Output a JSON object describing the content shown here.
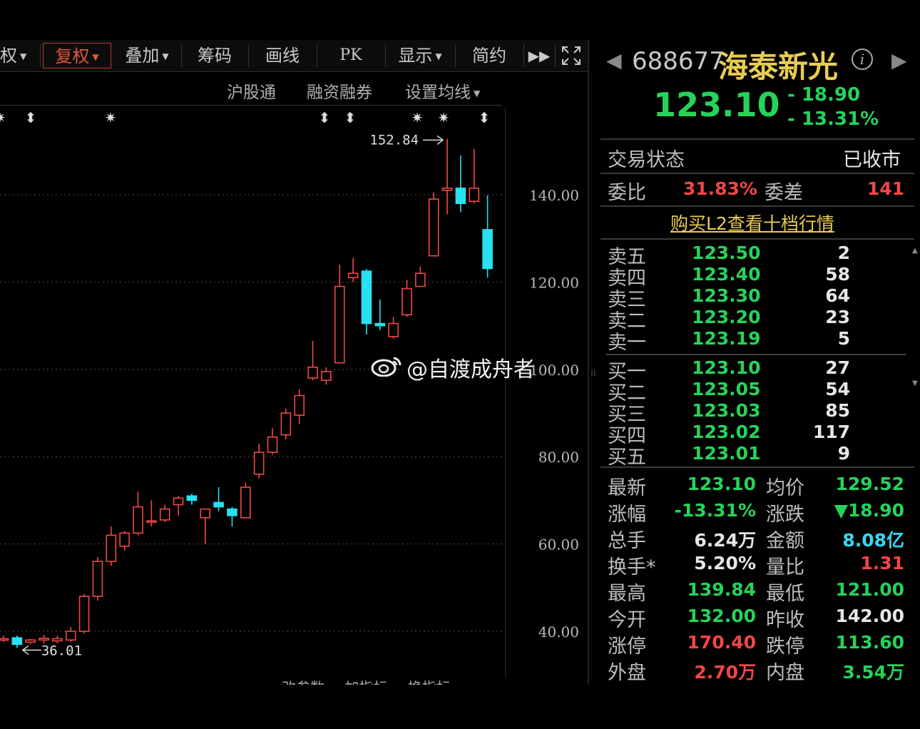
{
  "toolbar": {
    "items": [
      "复权",
      "叠加",
      "筹码",
      "画线",
      "PK",
      "显示",
      "简约"
    ],
    "partial_left": "权"
  },
  "subheader": {
    "hgt": "沪股通",
    "margin": "融资融券",
    "ma": "设置均线"
  },
  "chart": {
    "marker_high": "152.84",
    "marker_low": "36.01",
    "yticks": [
      "140.00",
      "120.00",
      "100.00",
      "80.00",
      "60.00",
      "40.00"
    ],
    "ytick_values": [
      140,
      120,
      100,
      80,
      60,
      40
    ]
  },
  "watermark": "@自渡成舟者",
  "bottom_tabs": [
    "改参数",
    "加指标",
    "换指标"
  ],
  "panel": {
    "code": "688677",
    "name": "海泰新光",
    "last": "123.10",
    "chg_abs": "- 18.90",
    "chg_pct": "- 13.31%",
    "status_label": "交易状态",
    "status_value": "已收市",
    "weibi_label": "委比",
    "weibi_value": "31.83%",
    "weicha_label": "委差",
    "weicha_value": "141",
    "l2_link": "购买L2查看十档行情",
    "asks": [
      {
        "label": "卖五",
        "price": "123.50",
        "vol": "2"
      },
      {
        "label": "卖四",
        "price": "123.40",
        "vol": "58"
      },
      {
        "label": "卖三",
        "price": "123.30",
        "vol": "64"
      },
      {
        "label": "卖二",
        "price": "123.20",
        "vol": "23"
      },
      {
        "label": "卖一",
        "price": "123.19",
        "vol": "5"
      }
    ],
    "bids": [
      {
        "label": "买一",
        "price": "123.10",
        "vol": "27"
      },
      {
        "label": "买二",
        "price": "123.05",
        "vol": "54"
      },
      {
        "label": "买三",
        "price": "123.03",
        "vol": "85"
      },
      {
        "label": "买四",
        "price": "123.02",
        "vol": "117"
      },
      {
        "label": "买五",
        "price": "123.01",
        "vol": "9"
      }
    ],
    "stats": [
      {
        "l1": "最新",
        "v1": "123.10",
        "c1": "green",
        "l2": "均价",
        "v2": "129.52",
        "c2": "green"
      },
      {
        "l1": "涨幅",
        "v1": "-13.31%",
        "c1": "green",
        "l2": "涨跌",
        "v2": "▼18.90",
        "c2": "green"
      },
      {
        "l1": "总手",
        "v1": "6.24万",
        "c1": "white",
        "l2": "金额",
        "v2": "8.08亿",
        "c2": "cyan"
      },
      {
        "l1": "换手*",
        "v1": "5.20%",
        "c1": "white",
        "l2": "量比",
        "v2": "1.31",
        "c2": "red"
      },
      {
        "l1": "最高",
        "v1": "139.84",
        "c1": "green",
        "l2": "最低",
        "v2": "121.00",
        "c2": "green"
      },
      {
        "l1": "今开",
        "v1": "132.00",
        "c1": "green",
        "l2": "昨收",
        "v2": "142.00",
        "c2": "white"
      },
      {
        "l1": "涨停",
        "v1": "170.40",
        "c1": "red",
        "l2": "跌停",
        "v2": "113.60",
        "c2": "green"
      },
      {
        "l1": "外盘",
        "v1": "2.70万",
        "c1": "red",
        "l2": "内盘",
        "v2": "3.54万",
        "c2": "green"
      }
    ]
  },
  "chart_data": {
    "type": "candlestick",
    "ylim": [
      34,
      156
    ],
    "yticks": [
      40,
      60,
      80,
      100,
      120,
      140
    ],
    "candles": [
      {
        "o": 38.0,
        "h": 39.0,
        "l": 37.5,
        "c": 38.3
      },
      {
        "o": 38.5,
        "h": 39.0,
        "l": 36.2,
        "c": 37.0
      },
      {
        "o": 37.5,
        "h": 38.3,
        "l": 37.0,
        "c": 38.0
      },
      {
        "o": 38.0,
        "h": 39.2,
        "l": 37.2,
        "c": 38.4
      },
      {
        "o": 37.8,
        "h": 39.0,
        "l": 37.2,
        "c": 38.3
      },
      {
        "o": 38.0,
        "h": 41.0,
        "l": 37.5,
        "c": 40.0
      },
      {
        "o": 40.0,
        "h": 48.5,
        "l": 39.5,
        "c": 48.0
      },
      {
        "o": 48.0,
        "h": 57.0,
        "l": 47.0,
        "c": 56.0
      },
      {
        "o": 56.0,
        "h": 64.0,
        "l": 55.0,
        "c": 62.0
      },
      {
        "o": 59.5,
        "h": 63.0,
        "l": 58.5,
        "c": 62.5
      },
      {
        "o": 62.5,
        "h": 72.0,
        "l": 62.0,
        "c": 68.5
      },
      {
        "o": 65.0,
        "h": 70.0,
        "l": 64.0,
        "c": 65.3
      },
      {
        "o": 65.5,
        "h": 69.0,
        "l": 65.0,
        "c": 68.0
      },
      {
        "o": 69.0,
        "h": 71.0,
        "l": 66.5,
        "c": 70.5
      },
      {
        "o": 71.0,
        "h": 71.5,
        "l": 69.0,
        "c": 70.0
      },
      {
        "o": 66.0,
        "h": 68.0,
        "l": 60.0,
        "c": 68.0
      },
      {
        "o": 69.5,
        "h": 73.0,
        "l": 67.5,
        "c": 68.5
      },
      {
        "o": 68.0,
        "h": 68.5,
        "l": 64.0,
        "c": 66.5
      },
      {
        "o": 66.0,
        "h": 74.0,
        "l": 66.0,
        "c": 73.0
      },
      {
        "o": 76.0,
        "h": 83.0,
        "l": 75.0,
        "c": 81.0
      },
      {
        "o": 81.0,
        "h": 86.5,
        "l": 80.5,
        "c": 84.5
      },
      {
        "o": 85.0,
        "h": 91.0,
        "l": 84.0,
        "c": 90.0
      },
      {
        "o": 89.5,
        "h": 95.5,
        "l": 87.5,
        "c": 94.0
      },
      {
        "o": 98.0,
        "h": 106.5,
        "l": 97.5,
        "c": 100.5
      },
      {
        "o": 97.5,
        "h": 100.5,
        "l": 96.5,
        "c": 99.5
      },
      {
        "o": 101.5,
        "h": 124.0,
        "l": 101.5,
        "c": 119.0
      },
      {
        "o": 121.0,
        "h": 125.5,
        "l": 120.0,
        "c": 122.0
      },
      {
        "o": 122.5,
        "h": 123.0,
        "l": 108.0,
        "c": 110.5
      },
      {
        "o": 110.5,
        "h": 116.0,
        "l": 109.0,
        "c": 110.0
      },
      {
        "o": 107.5,
        "h": 112.0,
        "l": 107.0,
        "c": 110.5
      },
      {
        "o": 112.5,
        "h": 120.5,
        "l": 112.0,
        "c": 118.5
      },
      {
        "o": 119.0,
        "h": 123.5,
        "l": 119.0,
        "c": 122.0
      },
      {
        "o": 126.0,
        "h": 140.5,
        "l": 126.0,
        "c": 139.0
      },
      {
        "o": 141.0,
        "h": 152.84,
        "l": 135.5,
        "c": 141.5
      },
      {
        "o": 141.5,
        "h": 149.0,
        "l": 136.0,
        "c": 138.0
      },
      {
        "o": 138.5,
        "h": 150.5,
        "l": 138.0,
        "c": 141.5
      },
      {
        "o": 132.0,
        "h": 139.84,
        "l": 121.0,
        "c": 123.1
      }
    ],
    "marker_high": 152.84,
    "marker_low": 36.01
  }
}
